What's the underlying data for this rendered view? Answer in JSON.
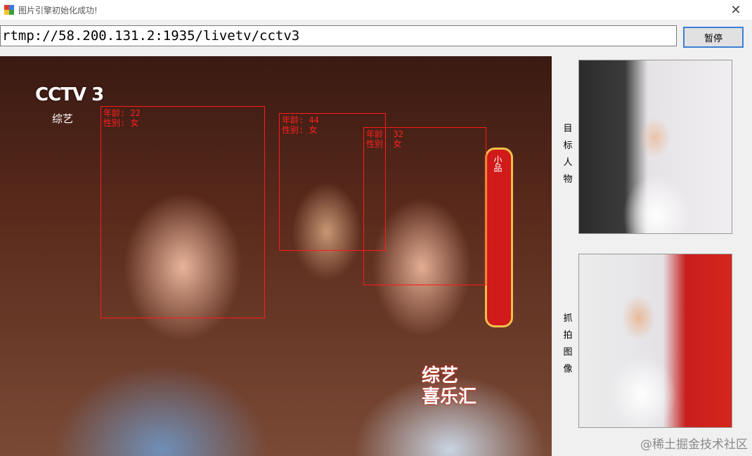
{
  "window": {
    "title": "图片引擎初始化成功!",
    "close_glyph": "✕"
  },
  "toolbar": {
    "url_value": "rtmp://58.200.131.2:1935/livetv/cctv3",
    "pause_label": "暂停"
  },
  "video": {
    "channel_logo": "CCTV 3",
    "channel_sub": "综艺",
    "banner_text": "小品",
    "show_logo_line1": "综艺",
    "show_logo_line2": "喜乐汇",
    "faces": [
      {
        "age": "年龄: 22",
        "gender": "性别: 女"
      },
      {
        "age": "年龄: 44",
        "gender": "性别: 女"
      },
      {
        "age": "年龄: 32",
        "gender": "性别: 女"
      }
    ]
  },
  "side": {
    "target_label": "目\n标\n人\n物",
    "capture_label": "抓\n拍\n图\n像"
  },
  "watermark": "@稀土掘金技术社区",
  "colors": {
    "face_box": "#ff1a1a",
    "button_border": "#3c7fd6"
  }
}
